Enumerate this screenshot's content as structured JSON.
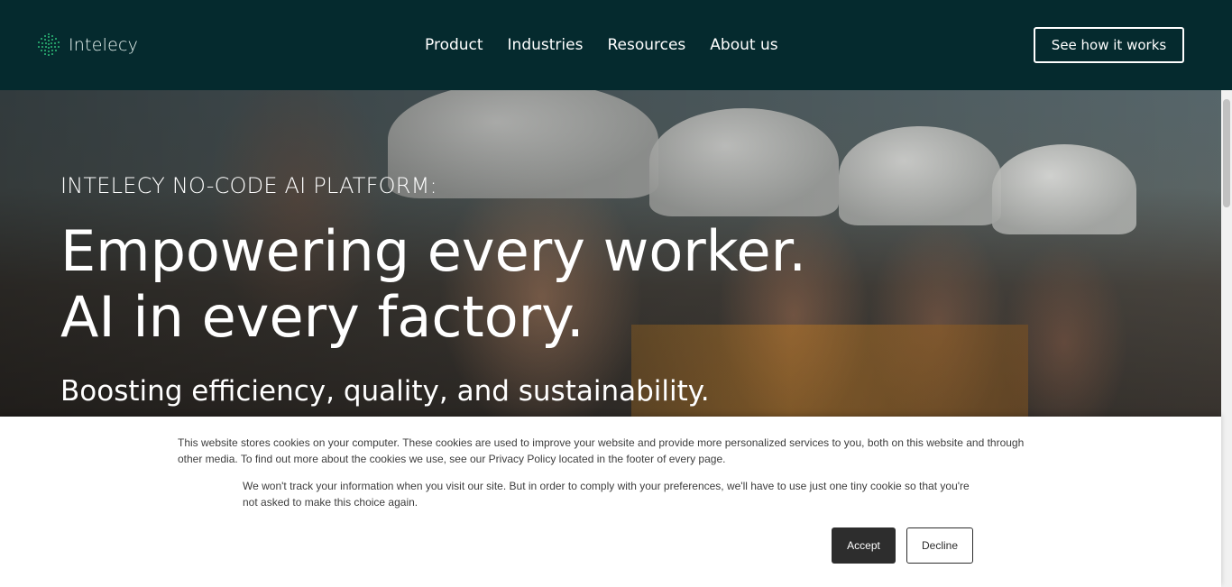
{
  "header": {
    "brand": "Intelecy",
    "nav": [
      {
        "label": "Product"
      },
      {
        "label": "Industries"
      },
      {
        "label": "Resources"
      },
      {
        "label": "About us"
      }
    ],
    "cta_label": "See how it works"
  },
  "hero": {
    "kicker": "INTELECY NO-CODE AI PLATFORM:",
    "title_line1": "Empowering every worker.",
    "title_line2": "AI in every factory.",
    "subtitle": "Boosting efficiency, quality, and sustainability."
  },
  "cookie_banner": {
    "text1": "This website stores cookies on your computer. These cookies are used to improve your website and provide more personalized services to you, both on this website and through other media. To find out more about the cookies we use, see our Privacy Policy located in the footer of every page.",
    "text2": "We won't track your information when you visit our site. But in order to comply with your preferences, we'll have to use just one tiny cookie so that you're not asked to make this choice again.",
    "accept_label": "Accept",
    "decline_label": "Decline"
  },
  "colors": {
    "header_bg": "#052a2e",
    "logo_accent": "#2fc07a",
    "accept_bg": "#2d2d2d"
  }
}
